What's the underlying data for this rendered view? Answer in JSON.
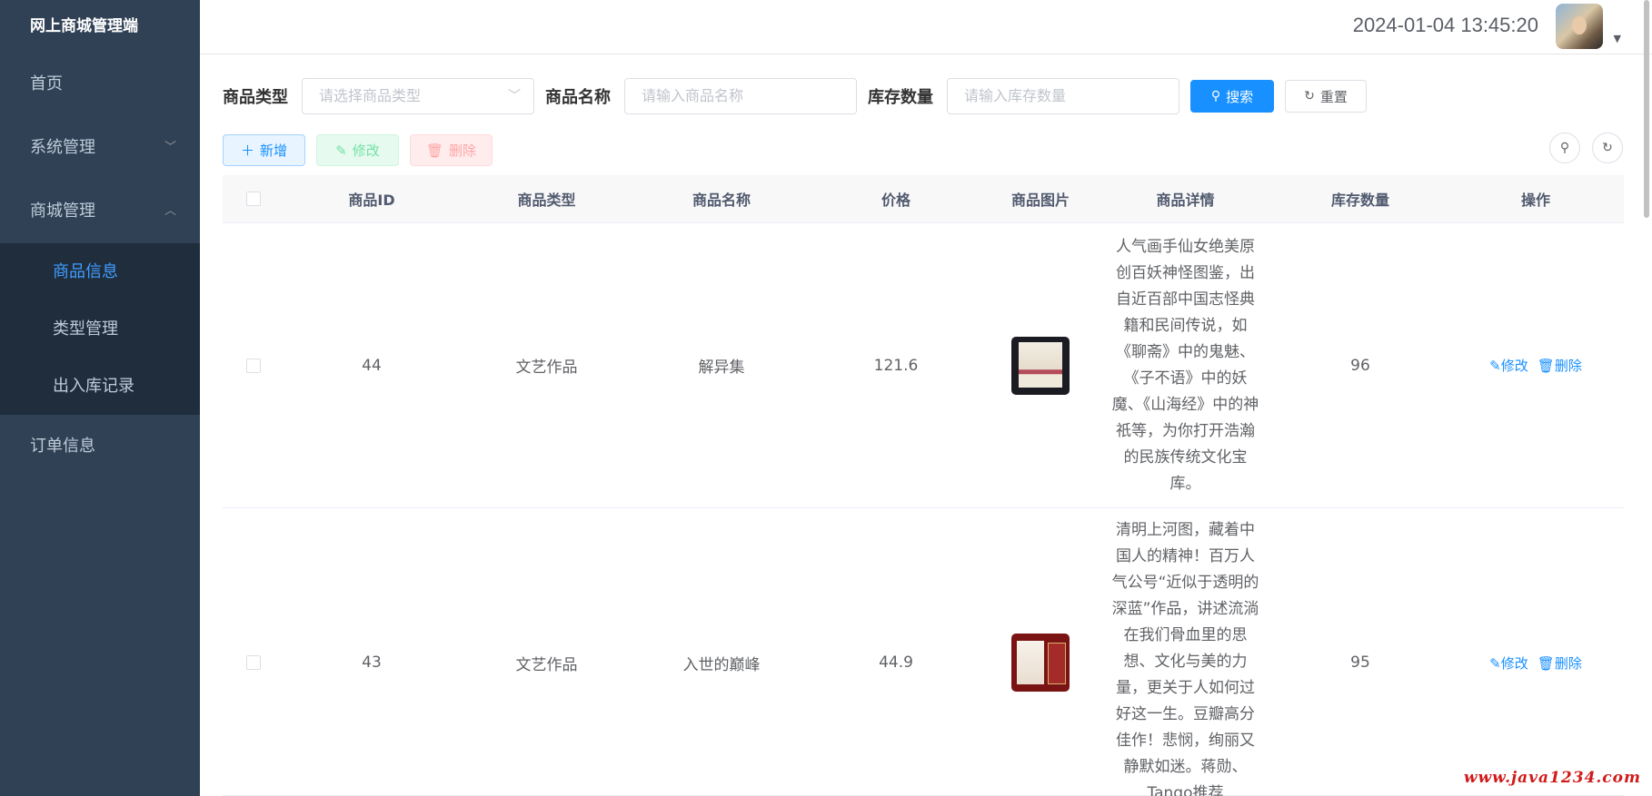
{
  "app": {
    "title": "网上商城管理端"
  },
  "sidebar": {
    "items": [
      {
        "label": "首页"
      },
      {
        "label": "系统管理"
      },
      {
        "label": "商城管理"
      },
      {
        "label": "订单信息"
      }
    ],
    "sub_items": [
      {
        "label": "商品信息",
        "active": true
      },
      {
        "label": "类型管理"
      },
      {
        "label": "出入库记录"
      }
    ]
  },
  "header": {
    "datetime": "2024-01-04 13:45:20"
  },
  "search": {
    "type_label": "商品类型",
    "type_placeholder": "请选择商品类型",
    "name_label": "商品名称",
    "name_placeholder": "请输入商品名称",
    "stock_label": "库存数量",
    "stock_placeholder": "请输入库存数量",
    "search_label": "搜索",
    "reset_label": "重置"
  },
  "toolbar": {
    "add_label": "新增",
    "edit_label": "修改",
    "delete_label": "删除"
  },
  "table": {
    "columns": [
      "商品ID",
      "商品类型",
      "商品名称",
      "价格",
      "商品图片",
      "商品详情",
      "库存数量",
      "操作"
    ],
    "rows": [
      {
        "id": "44",
        "type": "文艺作品",
        "name": "解异集",
        "price": "121.6",
        "detail": "人气画手仙女绝美原创百妖神怪图鉴，出自近百部中国志怪典籍和民间传说，如《聊斋》中的鬼魅、《子不语》中的妖魔、《山海经》中的神祇等，为你打开浩瀚的民族传统文化宝库。",
        "stock": "96",
        "op_edit": "修改",
        "op_delete": "删除"
      },
      {
        "id": "43",
        "type": "文艺作品",
        "name": "入世的巅峰",
        "price": "44.9",
        "detail": "清明上河图，藏着中国人的精神！百万人气公号“近似于透明的深蓝”作品，讲述流淌在我们骨血里的思想、文化与美的力量，更关于人如何过好这一生。豆瓣高分佳作！悲悯，绚丽又静默如迷。蒋勋、Tango推荐",
        "stock": "95",
        "op_edit": "修改",
        "op_delete": "删除"
      }
    ]
  },
  "watermark": "www.java1234.com"
}
